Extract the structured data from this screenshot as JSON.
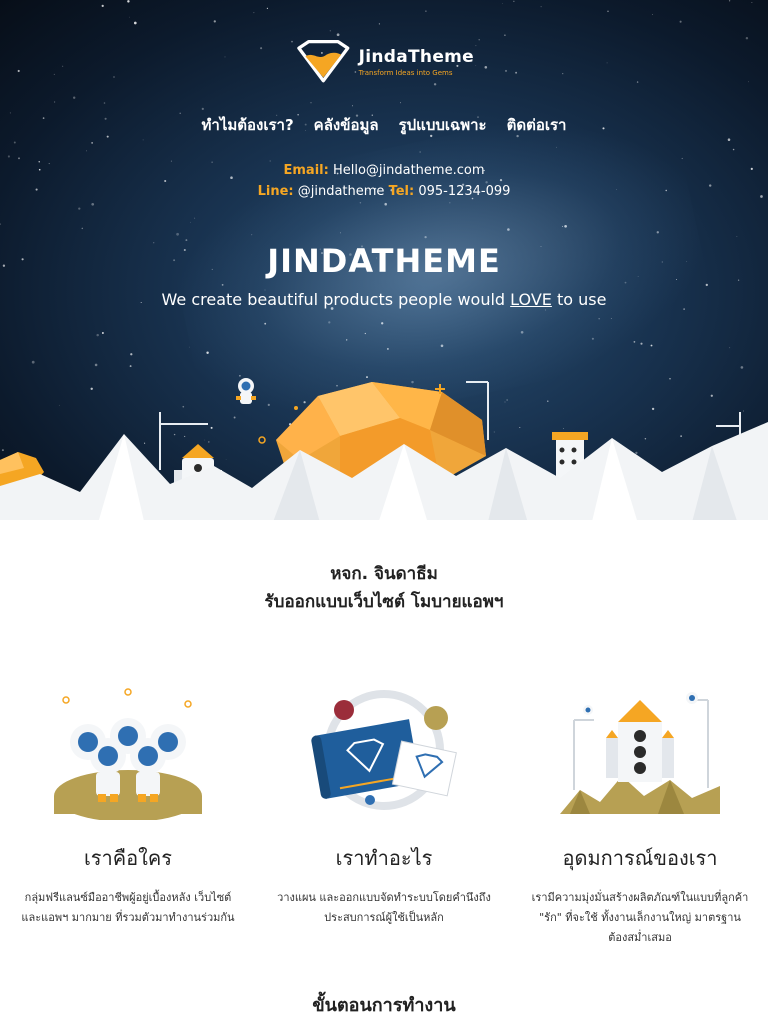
{
  "brand": {
    "name": "JindaTheme",
    "tagline": "Transform Ideas into Gems",
    "colors": {
      "accent": "#f5a623",
      "sky": "#18324f",
      "text": "#222222"
    }
  },
  "nav": {
    "items": [
      {
        "label": "ทำไมต้องเรา?"
      },
      {
        "label": "คลังข้อมูล"
      },
      {
        "label": "รูปแบบเฉพาะ"
      },
      {
        "label": "ติดต่อเรา"
      }
    ]
  },
  "contact": {
    "email_label": "Email:",
    "email": "Hello@jindatheme.com",
    "line_label": "Line:",
    "line": "@jindatheme",
    "tel_label": "Tel:",
    "tel": "095-1234-099"
  },
  "hero": {
    "title": "JINDATHEME",
    "subtitle_before": "We create beautiful products people would ",
    "subtitle_emphasis": "LOVE",
    "subtitle_after": " to use"
  },
  "intro": {
    "line1": "หจก. จินดาธีม",
    "line2": "รับออกแบบเว็บไซต์ โมบายแอพฯ"
  },
  "features": [
    {
      "icon": "astronaut-team-icon",
      "title": "เราคือใคร",
      "desc": "กลุ่มฟรีแลนซ์มืออาชีพผู้อยู่เบื้องหลัง เว็บไซต์ และแอพฯ มากมาย ที่รวมตัวมาทำงานร่วมกัน"
    },
    {
      "icon": "blueprint-plan-icon",
      "title": "เราทำอะไร",
      "desc": "วางแผน และออกแบบจัดทำระบบโดยคำนึงถึงประสบการณ์ผู้ใช้เป็นหลัก"
    },
    {
      "icon": "rocket-launch-icon",
      "title": "อุดมการณ์ของเรา",
      "desc": "เรามีความมุ่งมั่นสร้างผลิตภัณฑ์ในแบบที่ลูกค้า \"รัก\" ที่จะใช้ ทั้งงานเล็กงานใหญ่ มาตรฐานต้องสม่ำเสมอ"
    }
  ],
  "process": {
    "title": "ขั้นตอนการทำงาน"
  }
}
